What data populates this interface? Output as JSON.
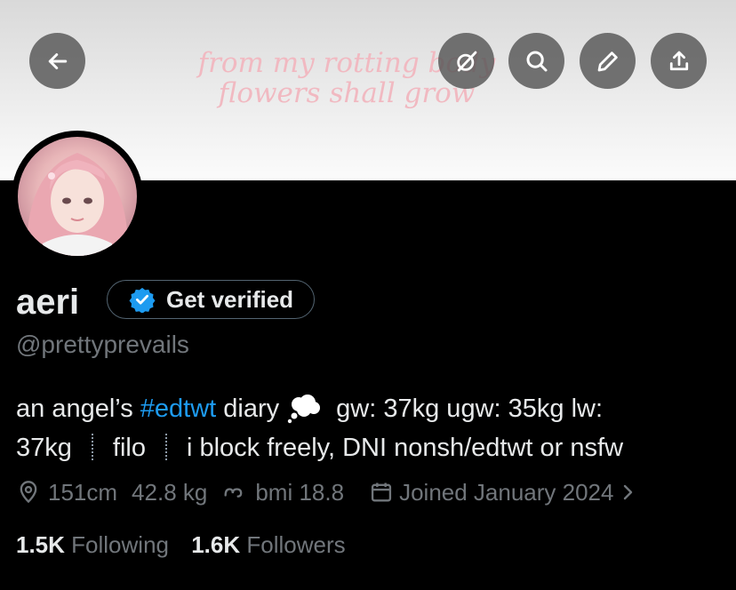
{
  "header": {
    "banner_line1": "from my rotting body",
    "banner_line2": "flowers shall grow",
    "buttons": [
      "back-arrow",
      "grok",
      "search",
      "edit",
      "share"
    ]
  },
  "profile": {
    "display_name": "aeri",
    "verify_label": "Get verified",
    "handle": "@prettyprevails",
    "bio": {
      "part1": "an angel’s ",
      "hashtag": "#edtwt",
      "part2": " diary",
      "part3": " gw: 37kg ugw: 35kg lw:",
      "part4": "37kg",
      "part5": "filo",
      "part6": "i block freely, DNI nonsh/edtwt or nsfw"
    },
    "meta": {
      "location": "151cm",
      "weight": "42.8 kg",
      "bmi": "bmi 18.8",
      "joined": "Joined January 2024"
    },
    "stats": {
      "following_count": "1.5K",
      "following_label": "Following",
      "followers_count": "1.6K",
      "followers_label": "Followers"
    }
  },
  "colors": {
    "accent": "#1d9bf0",
    "muted": "#71767b",
    "text": "#e7e9ea",
    "background": "#000000"
  }
}
